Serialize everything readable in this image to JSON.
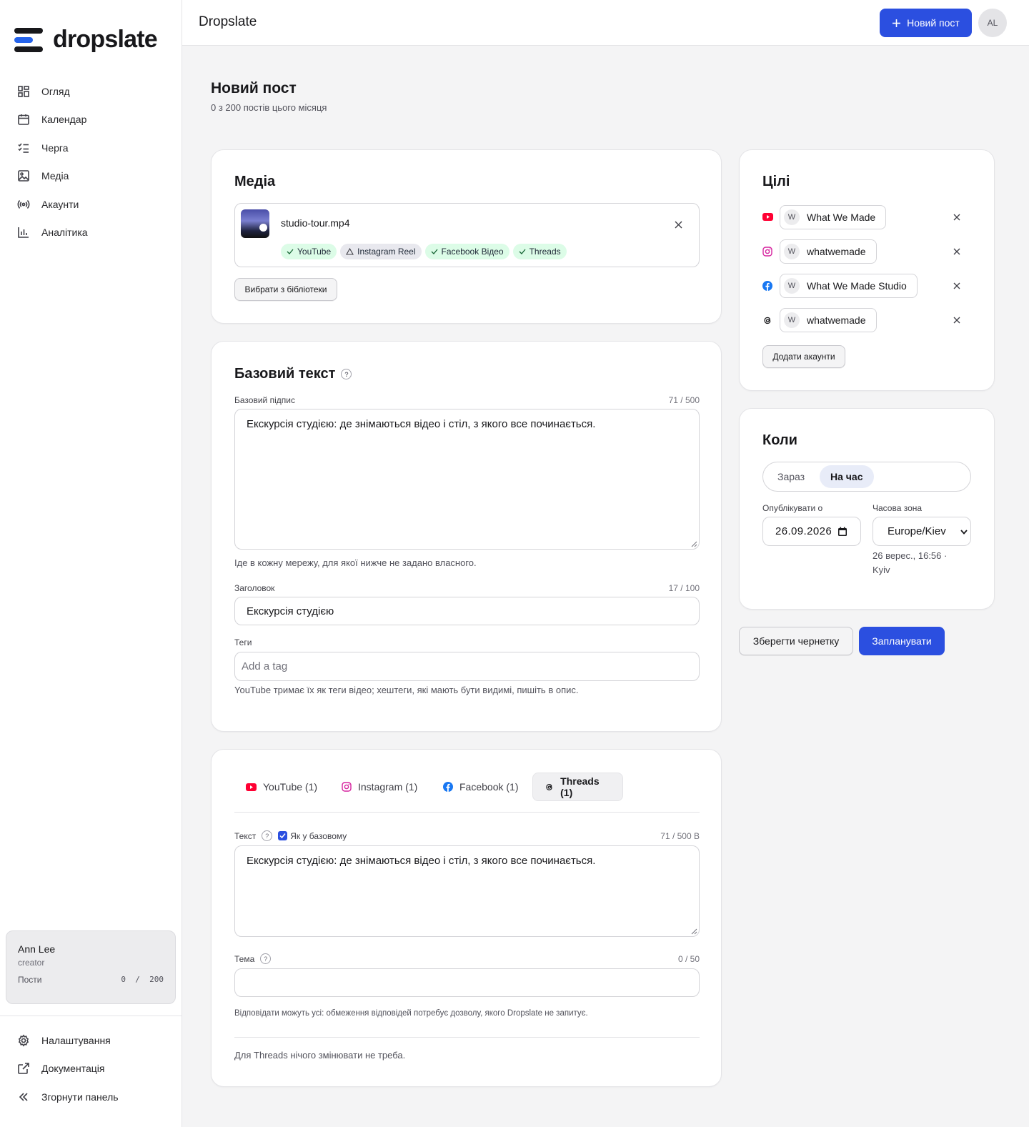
{
  "app": {
    "brand": "dropslate",
    "title": "Dropslate",
    "new_post_label": "Новий пост",
    "avatar_initials": "AL"
  },
  "sidebar": {
    "items": [
      {
        "label": "Огляд",
        "icon": "grid-icon"
      },
      {
        "label": "Календар",
        "icon": "calendar-icon"
      },
      {
        "label": "Черга",
        "icon": "queue-list-icon"
      },
      {
        "label": "Медіа",
        "icon": "image-icon"
      },
      {
        "label": "Акаунти",
        "icon": "broadcast-icon"
      },
      {
        "label": "Аналітика",
        "icon": "bar-chart-icon"
      }
    ],
    "user": {
      "name": "Ann Lee",
      "role": "creator",
      "posts_label": "Пости",
      "posts_used": "0",
      "posts_sep": "/",
      "posts_limit": "200"
    },
    "bottom": [
      {
        "label": "Налаштування",
        "icon": "gear-icon"
      },
      {
        "label": "Документація",
        "icon": "external-link-icon"
      },
      {
        "label": "Згорнути панель",
        "icon": "chevrons-left-icon"
      }
    ]
  },
  "page": {
    "title": "Новий пост",
    "subtitle": "0 з 200 постів цього місяця"
  },
  "media": {
    "title": "Медіа",
    "file_name": "studio-tour.mp4",
    "chips": [
      {
        "label": "YouTube",
        "status": "ok"
      },
      {
        "label": "Instagram Reel",
        "status": "warn"
      },
      {
        "label": "Facebook Відео",
        "status": "ok"
      },
      {
        "label": "Threads",
        "status": "ok"
      }
    ],
    "library_button": "Вибрати з бібліотеки"
  },
  "base_text": {
    "title": "Базовий текст",
    "caption_label": "Базовий підпис",
    "caption_counter": "71 / 500",
    "caption_value": "Екскурсія студією: де знімаються відео і стіл, з якого все починається.",
    "caption_help": "Іде в кожну мережу, для якої нижче не задано власного.",
    "headline_label": "Заголовок",
    "headline_counter": "17 / 100",
    "headline_value": "Екскурсія студією",
    "tags_label": "Теги",
    "tags_placeholder": "Add a tag",
    "tags_help": "YouTube тримає їх як теги відео; хештеги, які мають бути видимі, пишіть в опис."
  },
  "network": {
    "tabs": [
      {
        "label": "YouTube (1)",
        "icon": "youtube-icon"
      },
      {
        "label": "Instagram (1)",
        "icon": "instagram-icon"
      },
      {
        "label": "Facebook (1)",
        "icon": "facebook-icon"
      },
      {
        "label": "Threads (1)",
        "icon": "threads-icon",
        "active": true
      }
    ],
    "text_label": "Текст",
    "same_as_base_label": "Як у базовому",
    "same_as_base_checked": true,
    "text_counter": "71 / 500 B",
    "text_value": "Екскурсія студією: де знімаються відео і стіл, з якого все починається.",
    "topic_label": "Тема",
    "topic_counter": "0 / 50",
    "topic_value": "",
    "reply_help": "Відповідати можуть усі: обмеження відповідей потребує дозволу, якого Dropslate не запитує.",
    "footer_note": "Для Threads нічого змінювати не треба."
  },
  "targets": {
    "title": "Цілі",
    "rows": [
      {
        "network": "youtube",
        "icon": "youtube-icon",
        "initial": "W",
        "name": "What We Made"
      },
      {
        "network": "instagram",
        "icon": "instagram-icon",
        "initial": "W",
        "name": "whatwemade"
      },
      {
        "network": "facebook",
        "icon": "facebook-icon",
        "initial": "W",
        "name": "What We Made Studio"
      },
      {
        "network": "threads",
        "icon": "threads-icon",
        "initial": "W",
        "name": "whatwemade"
      }
    ],
    "add_button": "Додати акаунти"
  },
  "when": {
    "title": "Коли",
    "options": [
      "Зараз",
      "На час"
    ],
    "selected": "На час",
    "publish_label": "Опублікувати о",
    "date_value": "26.09.2026",
    "tz_label": "Часова зона",
    "tz_value": "Europe/Kiev",
    "tz_hint": "26 верес., 16:56 · Kyiv"
  },
  "actions": {
    "draft_button": "Зберегти чернетку",
    "schedule_button": "Запланувати"
  },
  "colors": {
    "accent": "#2b4fe0",
    "youtube": "#ff0033",
    "instagram": "#d6249f",
    "facebook": "#1877f2",
    "ok_chip": "#dcfce7"
  }
}
